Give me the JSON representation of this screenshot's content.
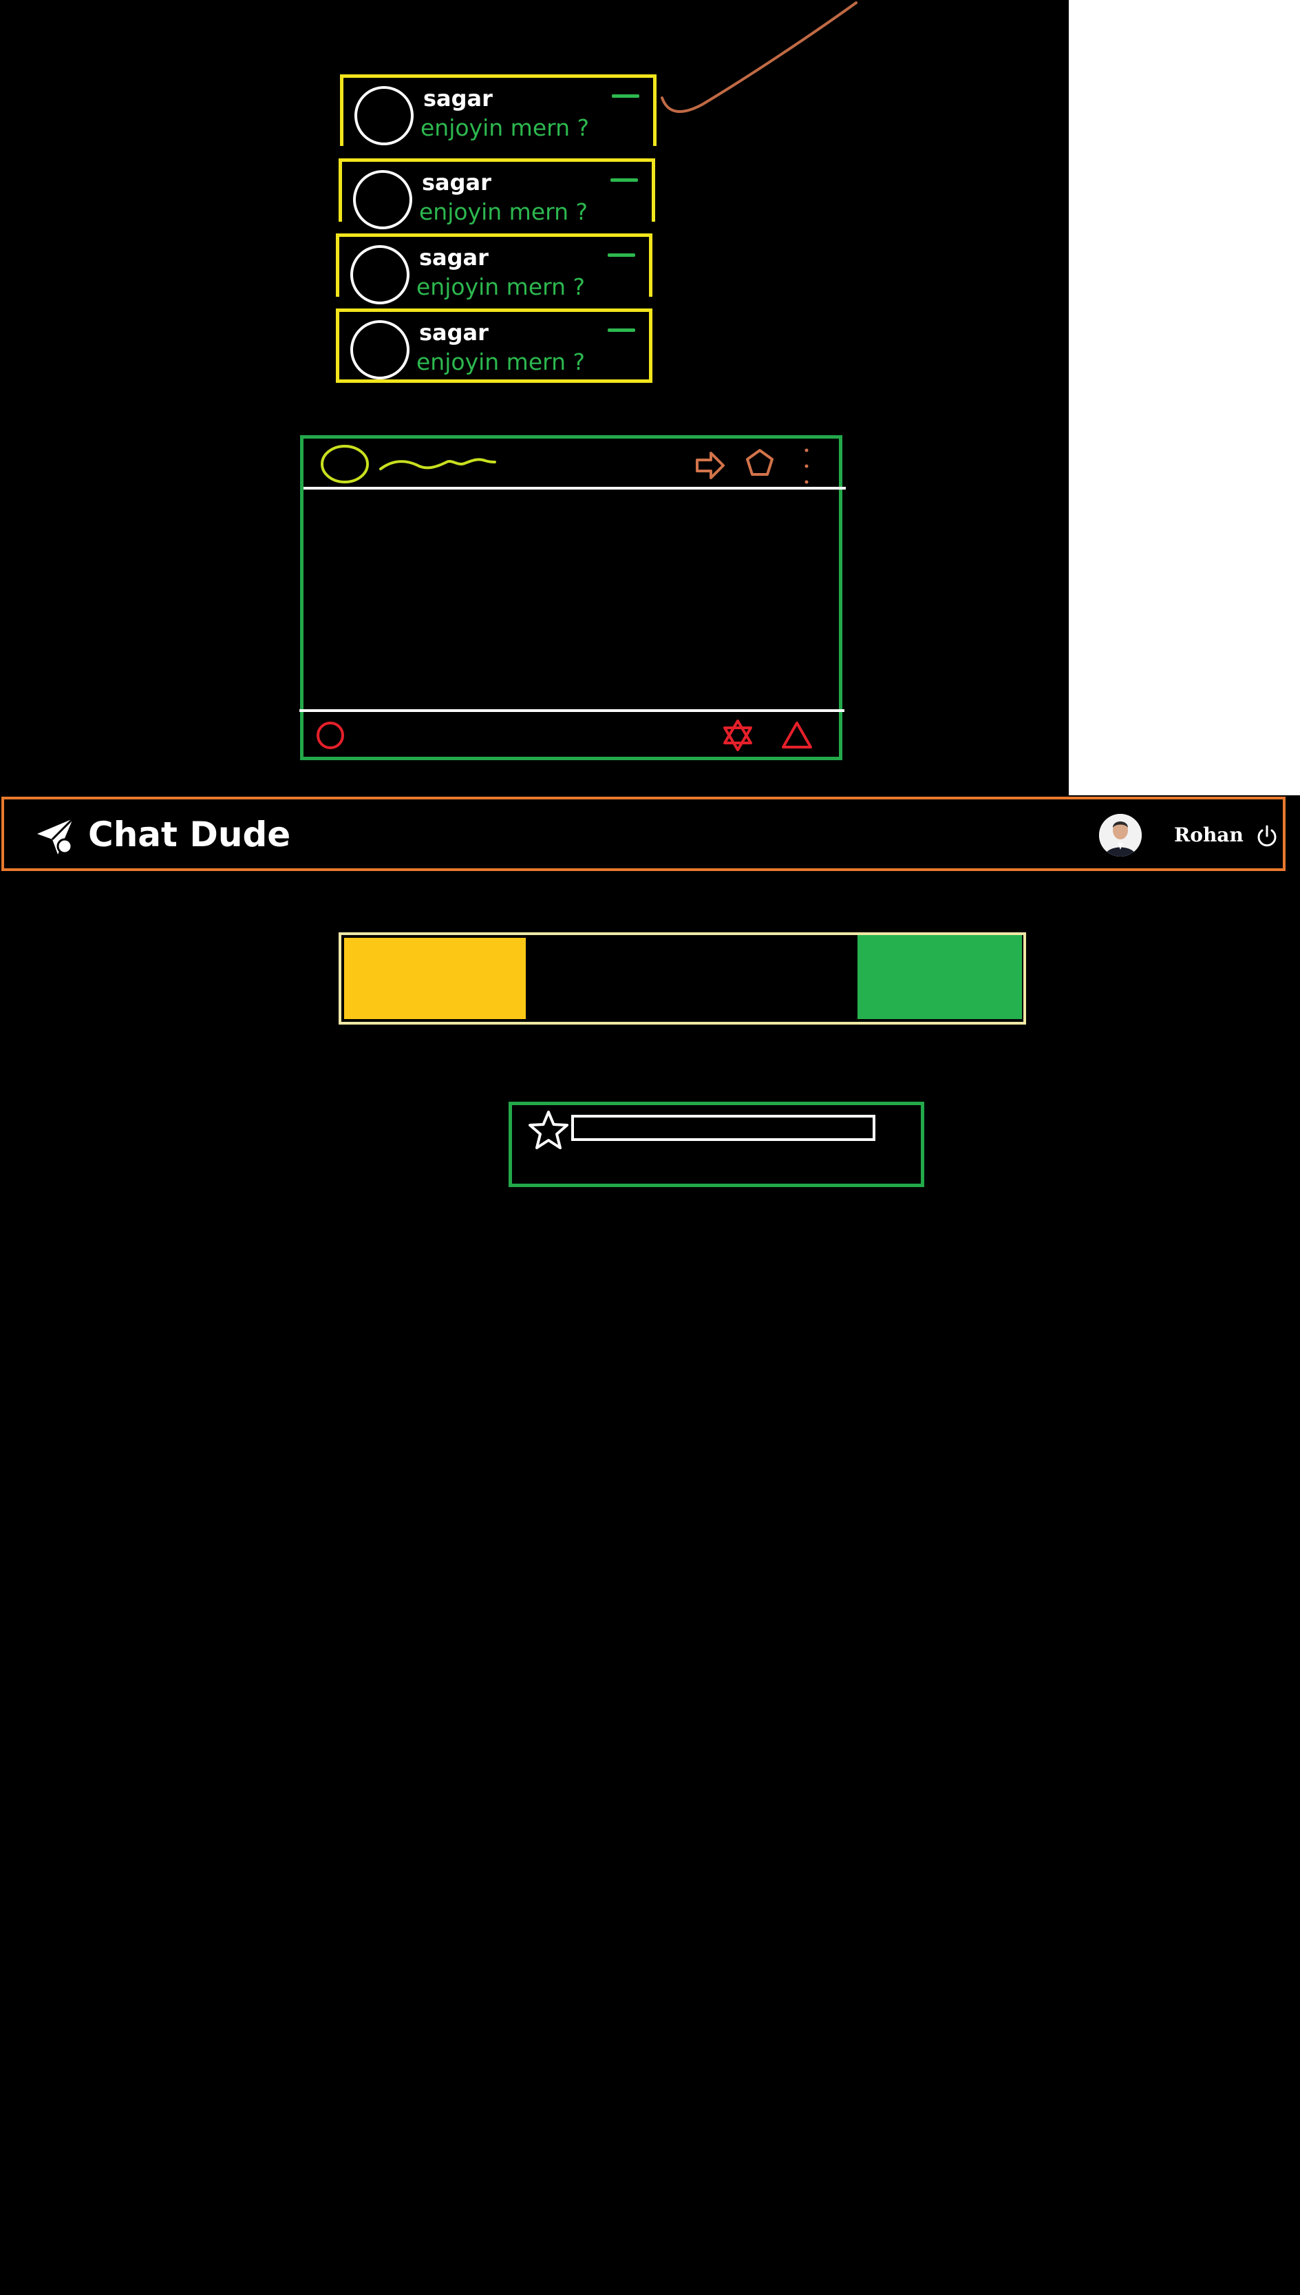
{
  "sketch": {
    "messages": [
      {
        "name": "sagar",
        "text": "enjoyin mern ?"
      },
      {
        "name": "sagar",
        "text": "enjoyin mern ?"
      },
      {
        "name": "sagar",
        "text": "enjoyin mern ?"
      },
      {
        "name": "sagar",
        "text": "enjoyin mern ?"
      }
    ]
  },
  "navbar": {
    "brand": "Chat Dude",
    "user": "Rohan"
  },
  "search": {
    "value": ""
  },
  "colors": {
    "message_border": "#f2e51d",
    "message_text": "#2db84f",
    "window_border": "#23a84a",
    "navbar_border": "#e8792e",
    "icon_orange": "#d2734a",
    "icon_red": "#e5202a",
    "bar_yellow": "#fdc815",
    "bar_green": "#25b24e"
  },
  "icons": {
    "brand": "paper-plane-icon",
    "power": "power-icon",
    "star": "star-icon"
  }
}
